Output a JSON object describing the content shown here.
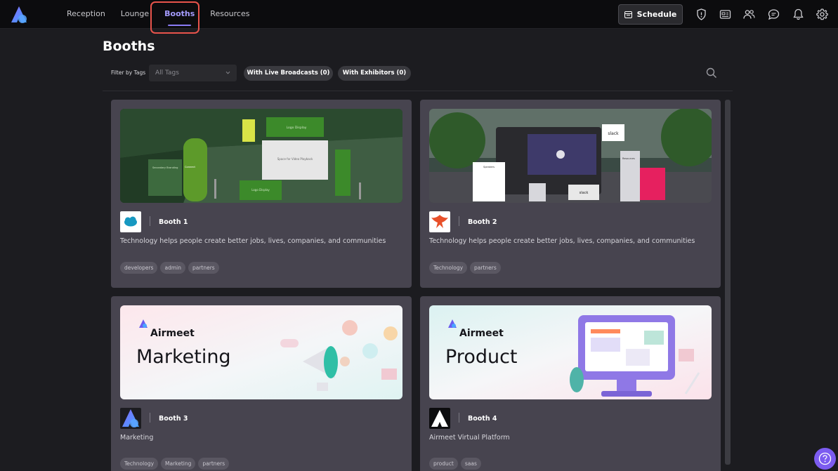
{
  "nav": {
    "items": [
      {
        "label": "Reception",
        "active": false
      },
      {
        "label": "Lounge",
        "active": false
      },
      {
        "label": "Booths",
        "active": true
      },
      {
        "label": "Resources",
        "active": false
      }
    ],
    "schedule_label": "Schedule",
    "icons": [
      "shield-icon",
      "news-icon",
      "people-icon",
      "chat-icon",
      "bell-icon",
      "gear-icon"
    ]
  },
  "page": {
    "title": "Booths",
    "filter_label": "Filter by Tags",
    "tag_placeholder": "All Tags",
    "filters": [
      "With Live Broadcasts (0)",
      "With Exhibitors (0)"
    ]
  },
  "banner_text": {
    "booth1_logo_display": "Logo Display",
    "booth1_video_placeholder": "Space for Video Playback",
    "booth1_secondary_branding": "Secondary Branding",
    "booth1_connect": "Connect",
    "booth2_logo_text": "slack",
    "booth2_speakers": "Speakers",
    "booth2_resources": "Resources",
    "airmeet_brand": "Airmeet",
    "marketing_title": "Marketing",
    "product_title": "Product"
  },
  "booths": [
    {
      "name": "Booth 1",
      "description": "Technology helps people create better jobs, lives, companies, and communities",
      "tags": [
        "developers",
        "admin",
        "partners"
      ],
      "logo": "salesforce-logo"
    },
    {
      "name": "Booth 2",
      "description": "Technology helps people create better jobs, lives, companies, and communities",
      "tags": [
        "Technology",
        "partners"
      ],
      "logo": "phoenix-logo"
    },
    {
      "name": "Booth 3",
      "description": "Marketing",
      "tags": [
        "Technology",
        "Marketing",
        "partners"
      ],
      "logo": "airmeet-gradient-logo"
    },
    {
      "name": "Booth 4",
      "description": "Airmeet Virtual Platform",
      "tags": [
        "product",
        "saas"
      ],
      "logo": "airmeet-white-logo"
    }
  ],
  "colors": {
    "accent": "#8b7cf6",
    "highlight": "#e8544c",
    "card_bg": "#47444f",
    "page_bg": "#1c1c20"
  }
}
